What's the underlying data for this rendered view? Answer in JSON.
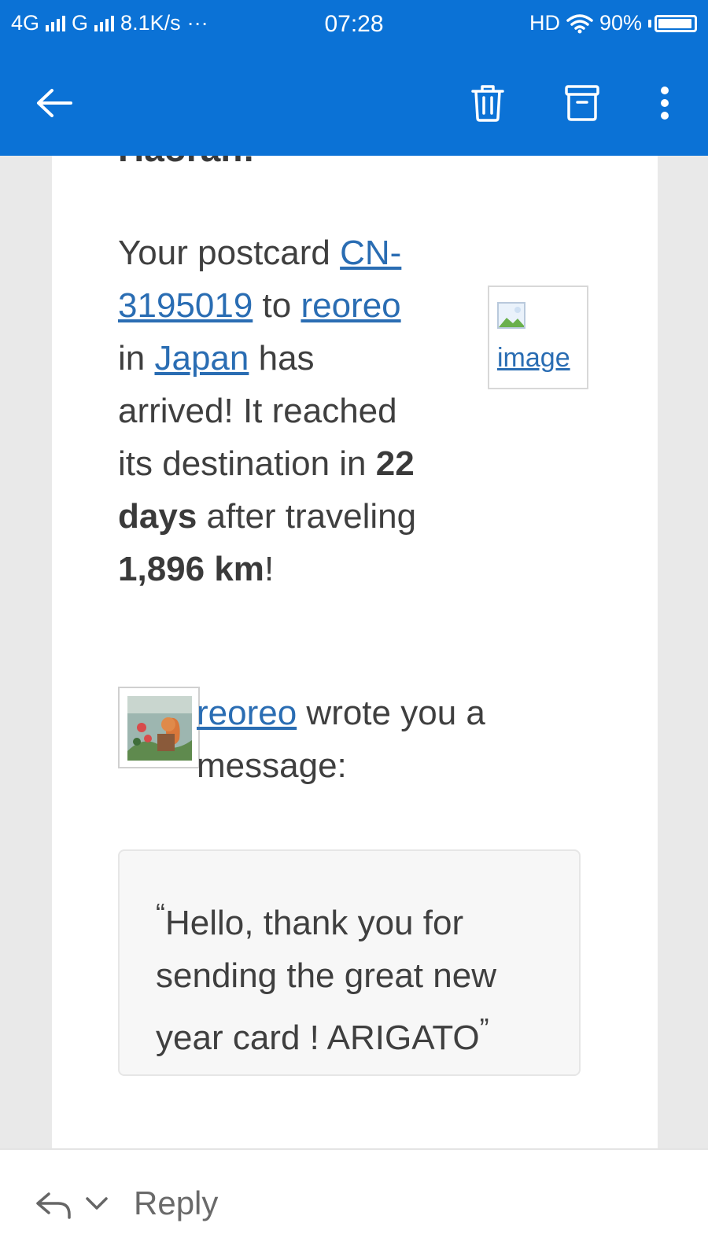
{
  "status_bar": {
    "network1": "4G",
    "network2": "G",
    "speed": "8.1K/s",
    "more": "···",
    "time": "07:28",
    "hd": "HD",
    "battery": "90%"
  },
  "toolbar": {
    "back_icon": "arrow-left-icon",
    "delete_icon": "trash-icon",
    "archive_icon": "archive-icon",
    "more_icon": "more-vertical-icon"
  },
  "email": {
    "greeting_partial": "Haoran:",
    "body": {
      "t1": "Your postcard ",
      "postcard_id": "CN-3195019",
      "t2": " to ",
      "recipient": "reoreo",
      "t3": " in ",
      "country": "Japan",
      "t4": " has arrived! It reached its destination in ",
      "days": "22 days",
      "t5": " after traveling ",
      "distance": "1,896 km",
      "t6": "!"
    },
    "broken_image_alt": "image",
    "sender": {
      "name": "reoreo",
      "text": " wrote you a message:"
    },
    "quote": {
      "open": "“",
      "text": "Hello, thank you for sending the great new year card ! ARIGATO",
      "close": "”"
    }
  },
  "bottom_bar": {
    "reply_label": "Reply"
  }
}
